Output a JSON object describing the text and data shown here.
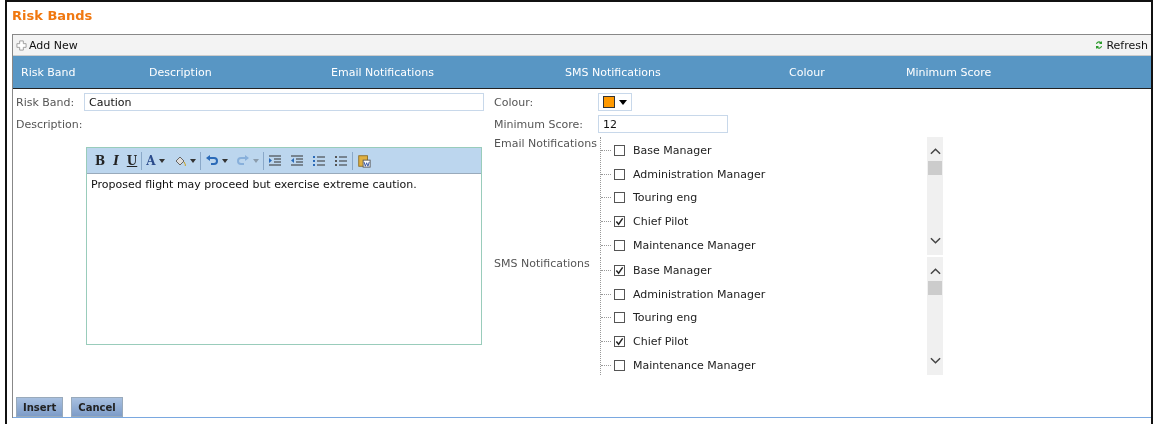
{
  "title": "Risk Bands",
  "toolbar": {
    "add_label": "Add New",
    "refresh_label": "Refresh"
  },
  "columns": [
    "Risk Band",
    "Description",
    "Email Notifications",
    "SMS Notifications",
    "Colour",
    "Minimum Score"
  ],
  "form": {
    "risk_band_label": "Risk Band:",
    "risk_band_value": "Caution",
    "description_label": "Description:",
    "description_text": "Proposed flight may proceed but exercise extreme caution.",
    "colour_label": "Colour:",
    "colour_picker": {
      "color": "#ff9900"
    },
    "min_score_label": "Minimum Score:",
    "min_score_value": "12"
  },
  "editor_tools": [
    {
      "kind": "bold",
      "label": "B",
      "dropdown": false,
      "disabled": false
    },
    {
      "kind": "italic",
      "label": "I",
      "dropdown": false,
      "disabled": false
    },
    {
      "kind": "underline",
      "label": "U",
      "dropdown": false,
      "disabled": false
    },
    {
      "kind": "font-color",
      "label": "A",
      "dropdown": true,
      "disabled": false
    },
    {
      "kind": "highlight",
      "dropdown": true,
      "disabled": false
    },
    {
      "kind": "undo",
      "dropdown": true,
      "disabled": false
    },
    {
      "kind": "redo",
      "dropdown": true,
      "disabled": true
    },
    {
      "kind": "indent",
      "dropdown": false,
      "disabled": false
    },
    {
      "kind": "outdent",
      "dropdown": false,
      "disabled": false
    },
    {
      "kind": "ordered-list",
      "dropdown": false,
      "disabled": false
    },
    {
      "kind": "bullet-list",
      "dropdown": false,
      "disabled": false
    },
    {
      "kind": "paste-word",
      "dropdown": false,
      "disabled": false
    }
  ],
  "notifications": [
    {
      "label": "Email Notifications",
      "items": [
        {
          "label": "Base Manager",
          "checked": false
        },
        {
          "label": "Administration Manager",
          "checked": false
        },
        {
          "label": "Touring eng",
          "checked": false
        },
        {
          "label": "Chief Pilot",
          "checked": true
        },
        {
          "label": "Maintenance Manager",
          "checked": false
        }
      ]
    },
    {
      "label": "SMS Notifications",
      "items": [
        {
          "label": "Base Manager",
          "checked": true
        },
        {
          "label": "Administration Manager",
          "checked": false
        },
        {
          "label": "Touring eng",
          "checked": false
        },
        {
          "label": "Chief Pilot",
          "checked": true
        },
        {
          "label": "Maintenance Manager",
          "checked": false
        }
      ]
    }
  ],
  "buttons": [
    "Insert",
    "Cancel"
  ]
}
